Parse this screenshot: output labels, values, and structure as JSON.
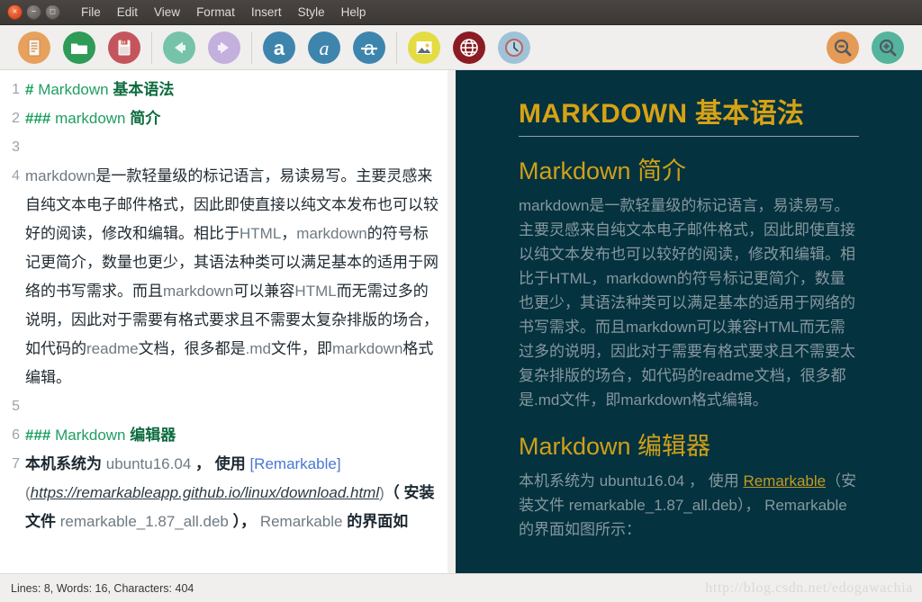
{
  "window": {
    "controls": [
      {
        "name": "close",
        "glyph": "×"
      },
      {
        "name": "minimize",
        "glyph": "−"
      },
      {
        "name": "maximize",
        "glyph": "□"
      }
    ],
    "menus": [
      "File",
      "Edit",
      "View",
      "Format",
      "Insert",
      "Style",
      "Help"
    ]
  },
  "toolbar": {
    "groups": [
      {
        "buttons": [
          {
            "icon": "new-document-icon",
            "label": "New",
            "color": "#e8a15c"
          },
          {
            "icon": "open-folder-icon",
            "label": "Open",
            "color": "#2e9b57"
          },
          {
            "icon": "save-icon",
            "label": "Save",
            "color": "#c5555c"
          }
        ]
      },
      {
        "buttons": [
          {
            "icon": "undo-arrow-icon",
            "label": "Undo",
            "color": "#76c3aa"
          },
          {
            "icon": "redo-arrow-icon",
            "label": "Redo",
            "color": "#c3b0dd"
          }
        ]
      },
      {
        "buttons": [
          {
            "icon": "bold-a-icon",
            "label": "Bold",
            "color": "#3e85ae"
          },
          {
            "icon": "italic-a-icon",
            "label": "Italic",
            "color": "#3e85ae"
          },
          {
            "icon": "strikethrough-a-icon",
            "label": "Strikethrough",
            "color": "#3e85ae"
          }
        ]
      },
      {
        "buttons": [
          {
            "icon": "image-icon",
            "label": "Insert Image",
            "color": "#e3dc42"
          },
          {
            "icon": "globe-link-icon",
            "label": "Insert Link",
            "color": "#8b1c23"
          },
          {
            "icon": "clock-history-icon",
            "label": "Recent",
            "color": "#9ec3d8"
          }
        ]
      }
    ],
    "right_buttons": [
      {
        "icon": "zoom-out-icon",
        "label": "Zoom Out",
        "color": "#e59a56"
      },
      {
        "icon": "zoom-in-icon",
        "label": "Zoom In",
        "color": "#54b49c"
      }
    ]
  },
  "editor": {
    "lines": [
      {
        "number": "1",
        "segments": [
          {
            "cls": "md-sym",
            "text": "# "
          },
          {
            "cls": "md-h-lat",
            "text": "Markdown "
          },
          {
            "cls": "md-h-cjk",
            "text": "基本语法"
          }
        ]
      },
      {
        "number": "2",
        "segments": [
          {
            "cls": "md-sym",
            "text": "### "
          },
          {
            "cls": "md-h-lat",
            "text": "markdown "
          },
          {
            "cls": "md-h-cjk",
            "text": "简介"
          }
        ]
      },
      {
        "number": "3",
        "segments": []
      },
      {
        "number": "4",
        "segments": [
          {
            "cls": "lat",
            "text": "markdown"
          },
          {
            "cls": "cjk",
            "text": "是一款轻量级的标记语言，易读易写。主要灵感来自纯文本电子邮件格式，因此即使直接以纯文本发布也可以较好的阅读，修改和编辑。相比于"
          },
          {
            "cls": "lat",
            "text": "HTML"
          },
          {
            "cls": "cjk",
            "text": "，"
          },
          {
            "cls": "lat",
            "text": "markdown"
          },
          {
            "cls": "cjk",
            "text": "的符号标记更简介，数量也更少，其语法种类可以满足基本的适用于网络的书写需求。而且"
          },
          {
            "cls": "lat",
            "text": "markdown"
          },
          {
            "cls": "cjk",
            "text": "可以兼容"
          },
          {
            "cls": "lat",
            "text": "HTML"
          },
          {
            "cls": "cjk",
            "text": "而无需过多的说明，因此对于需要有格式要求且不需要太复杂排版的场合，如代码的"
          },
          {
            "cls": "lat",
            "text": "readme"
          },
          {
            "cls": "cjk",
            "text": "文档，很多都是"
          },
          {
            "cls": "lat",
            "text": ".md"
          },
          {
            "cls": "cjk",
            "text": "文件，即"
          },
          {
            "cls": "lat",
            "text": "markdown"
          },
          {
            "cls": "cjk",
            "text": "格式编辑。"
          }
        ]
      },
      {
        "number": "5",
        "segments": []
      },
      {
        "number": "6",
        "segments": [
          {
            "cls": "md-sym",
            "text": "### "
          },
          {
            "cls": "md-h-lat",
            "text": "Markdown "
          },
          {
            "cls": "md-h-cjk",
            "text": "编辑器"
          }
        ]
      },
      {
        "number": "7",
        "segments": [
          {
            "cls": "cjk-b",
            "text": "本机系统为 "
          },
          {
            "cls": "lat",
            "text": "ubuntu16.04 "
          },
          {
            "cls": "cjk-b",
            "text": "， 使用 "
          },
          {
            "cls": "md-link",
            "text": "[Remarkable]"
          },
          {
            "cls": "lat",
            "text": "("
          },
          {
            "cls": "md-url",
            "text": "https://remarkableapp.github.io/linux/download.html"
          },
          {
            "cls": "lat",
            "text": ")"
          },
          {
            "cls": "cjk-b",
            "text": "（ 安装文件 "
          },
          {
            "cls": "lat",
            "text": "remarkable_1.87_all.deb "
          },
          {
            "cls": "cjk-b",
            "text": "）， "
          },
          {
            "cls": "lat",
            "text": "Remarkable "
          },
          {
            "cls": "cjk-b",
            "text": "的界面如"
          }
        ]
      }
    ]
  },
  "preview": {
    "h1": "MARKDOWN 基本语法",
    "h2_intro": "Markdown 简介",
    "paragraph_intro": "markdown是一款轻量级的标记语言，易读易写。主要灵感来自纯文本电子邮件格式，因此即使直接以纯文本发布也可以较好的阅读，修改和编辑。相比于HTML，markdown的符号标记更简介，数量也更少，其语法种类可以满足基本的适用于网络的书写需求。而且markdown可以兼容HTML而无需过多的说明，因此对于需要有格式要求且不需要太复杂排版的场合，如代码的readme文档，很多都是.md文件，即markdown格式编辑。",
    "h2_editor": "Markdown 编辑器",
    "para_editor_pre": "本机系统为 ubuntu16.04 ， 使用 ",
    "para_editor_link": "Remarkable",
    "para_editor_post": "（安装文件 remarkable_1.87_all.deb）， Remarkable 的界面如图所示："
  },
  "statusbar": {
    "info": "Lines: 8, Words: 16, Characters: 404",
    "watermark": "http://blog.csdn.net/edogawachia"
  }
}
